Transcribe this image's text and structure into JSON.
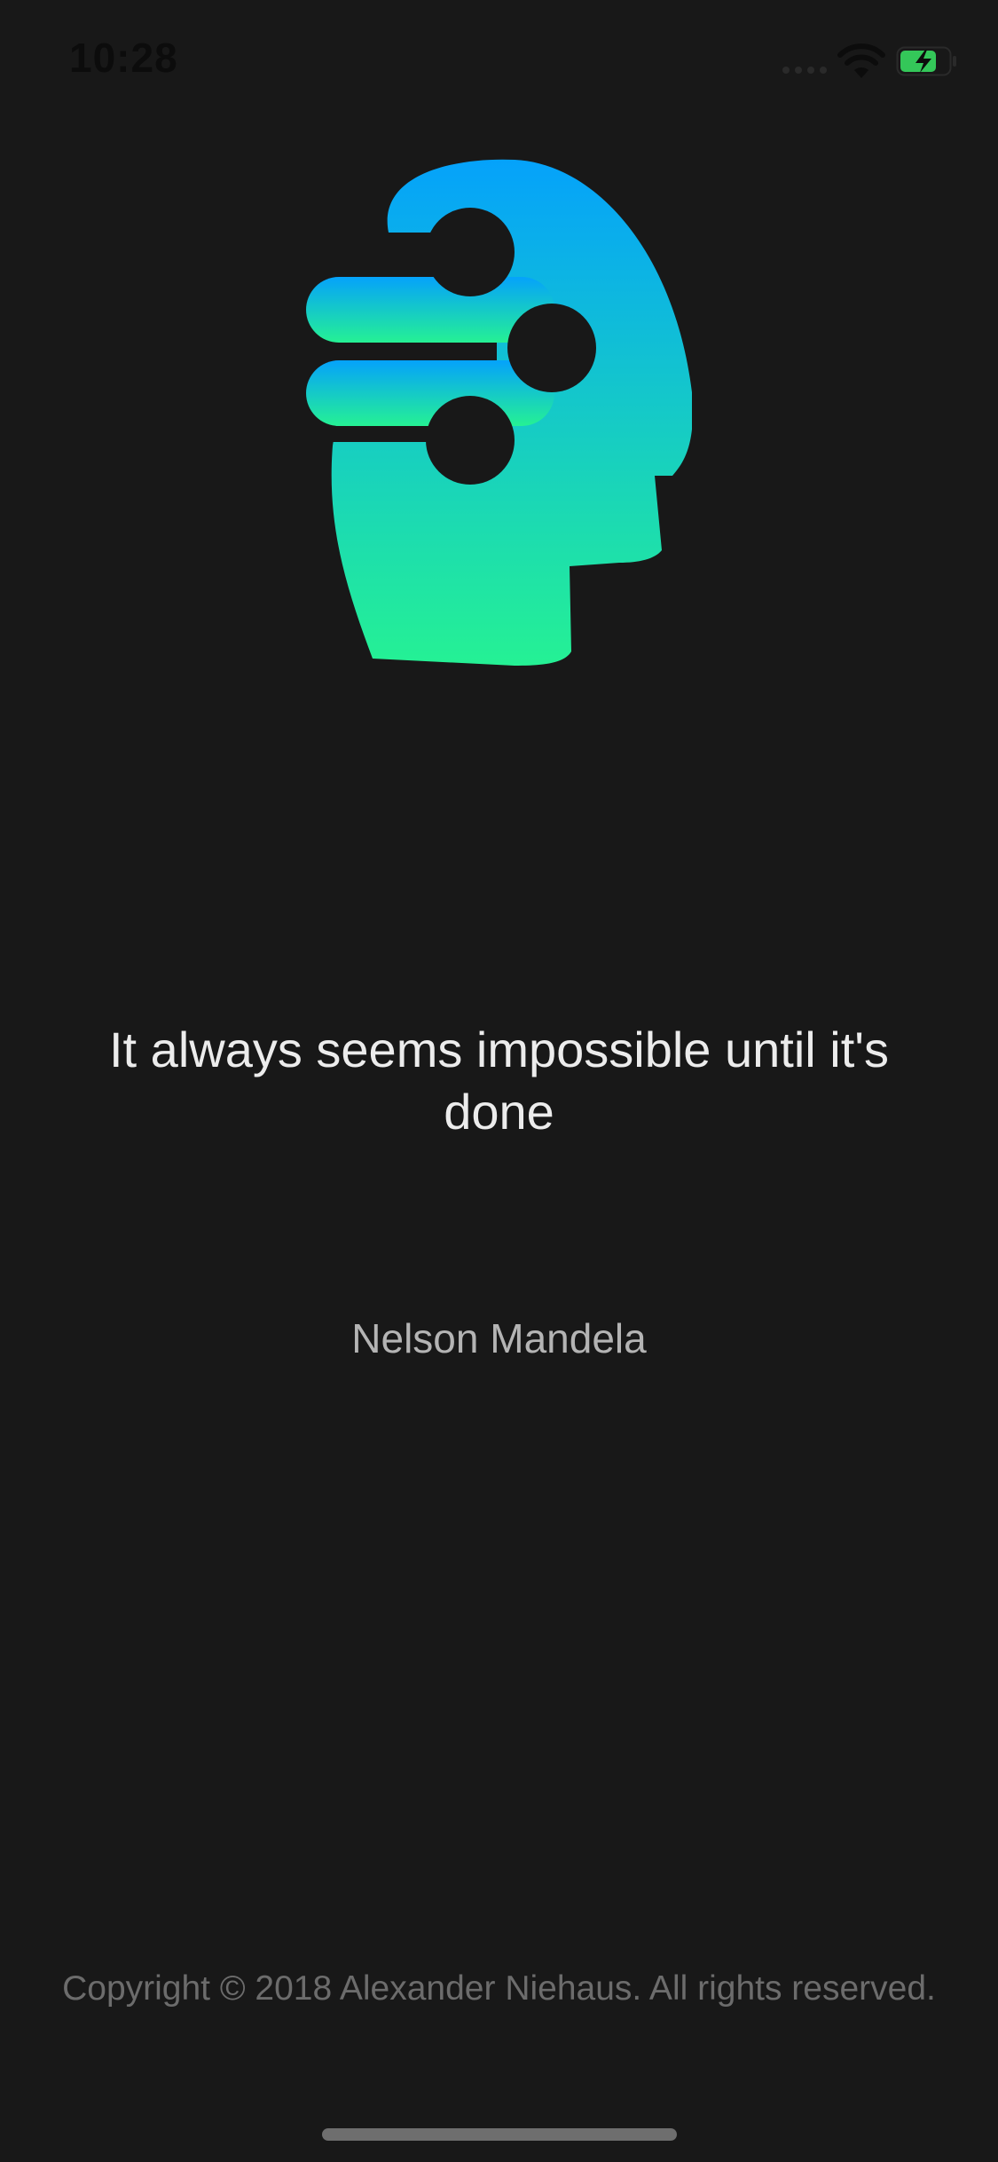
{
  "status_bar": {
    "time": "10:28",
    "icons": [
      "signal-icon",
      "wifi-icon",
      "battery-charging-icon"
    ]
  },
  "logo": {
    "icon": "head-circuit-logo-icon",
    "gradient_top": "#05A2FB",
    "gradient_bottom": "#25F194"
  },
  "quote": {
    "text": "It always seems impossible until it's done",
    "author": "Nelson Mandela"
  },
  "footer": {
    "copyright": "Copyright © 2018 Alexander Niehaus. All rights reserved."
  },
  "colors": {
    "background": "#181818",
    "quote_text": "#ececec",
    "author_text": "#b4b4b4",
    "copyright_text": "#6c6c6c",
    "battery_green": "#34C759"
  }
}
